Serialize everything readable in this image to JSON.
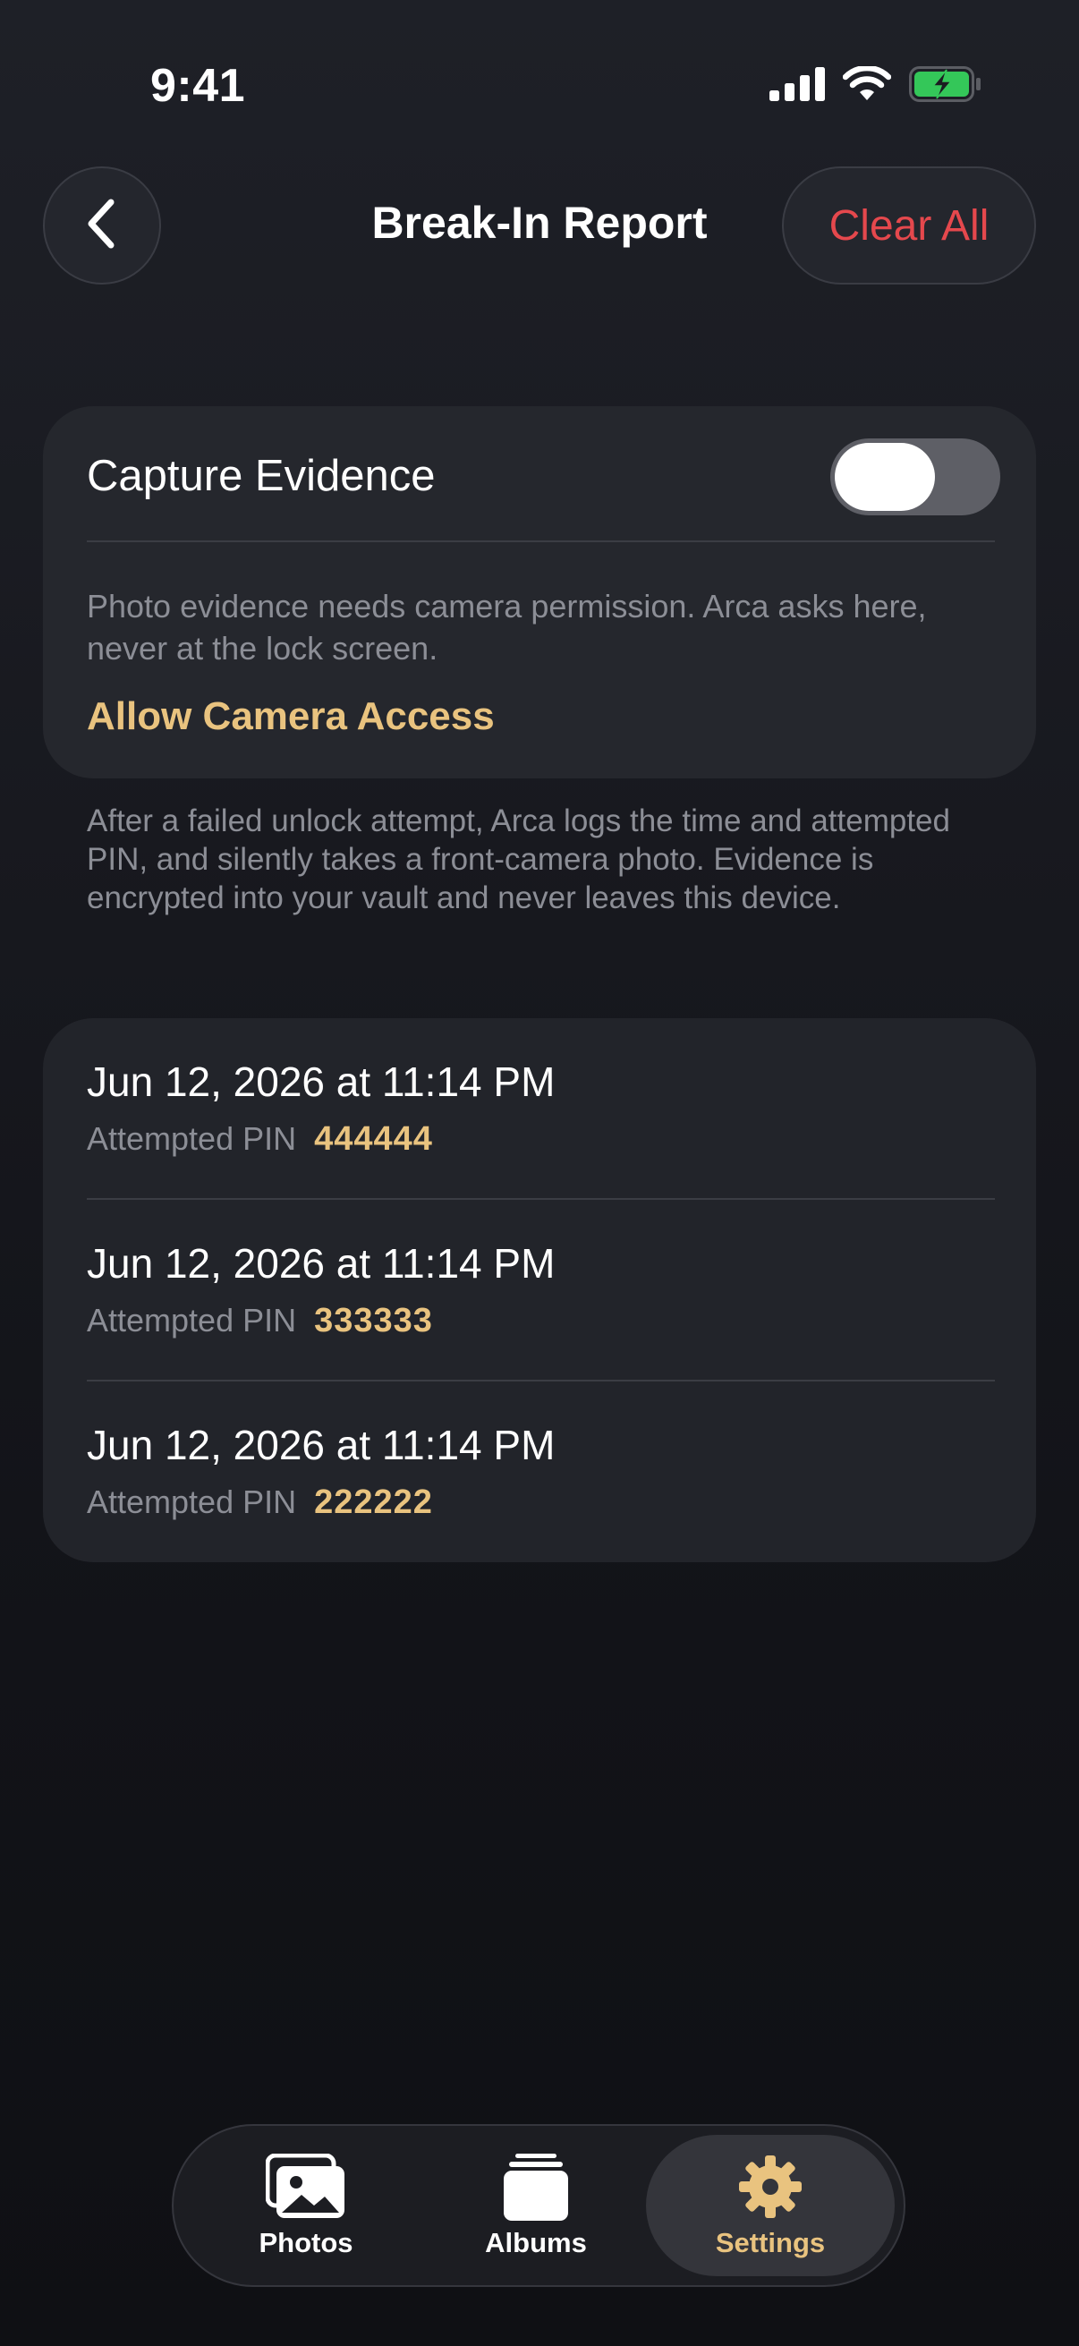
{
  "status_bar": {
    "time": "9:41"
  },
  "header": {
    "title": "Break-In Report",
    "clear_all_label": "Clear All"
  },
  "capture": {
    "label": "Capture Evidence",
    "toggle_on": false,
    "description": "Photo evidence needs camera permission. Arca asks here, never at the lock screen.",
    "allow_link": "Allow Camera Access"
  },
  "footnote": "After a failed unlock attempt, Arca logs the time and attempted PIN, and silently takes a front-camera photo. Evidence is encrypted into your vault and never leaves this device.",
  "log": {
    "entries": [
      {
        "date": "Jun 12, 2026 at 11:14 PM",
        "pin_label": "Attempted PIN",
        "pin": "444444"
      },
      {
        "date": "Jun 12, 2026 at 11:14 PM",
        "pin_label": "Attempted PIN",
        "pin": "333333"
      },
      {
        "date": "Jun 12, 2026 at 11:14 PM",
        "pin_label": "Attempted PIN",
        "pin": "222222"
      }
    ]
  },
  "tabs": [
    {
      "label": "Photos",
      "icon": "photos-icon",
      "active": false
    },
    {
      "label": "Albums",
      "icon": "albums-icon",
      "active": false
    },
    {
      "label": "Settings",
      "icon": "gear-icon",
      "active": true
    }
  ],
  "colors": {
    "accent": "#e9c37f",
    "destructive": "#e5484d",
    "battery": "#34c759"
  }
}
